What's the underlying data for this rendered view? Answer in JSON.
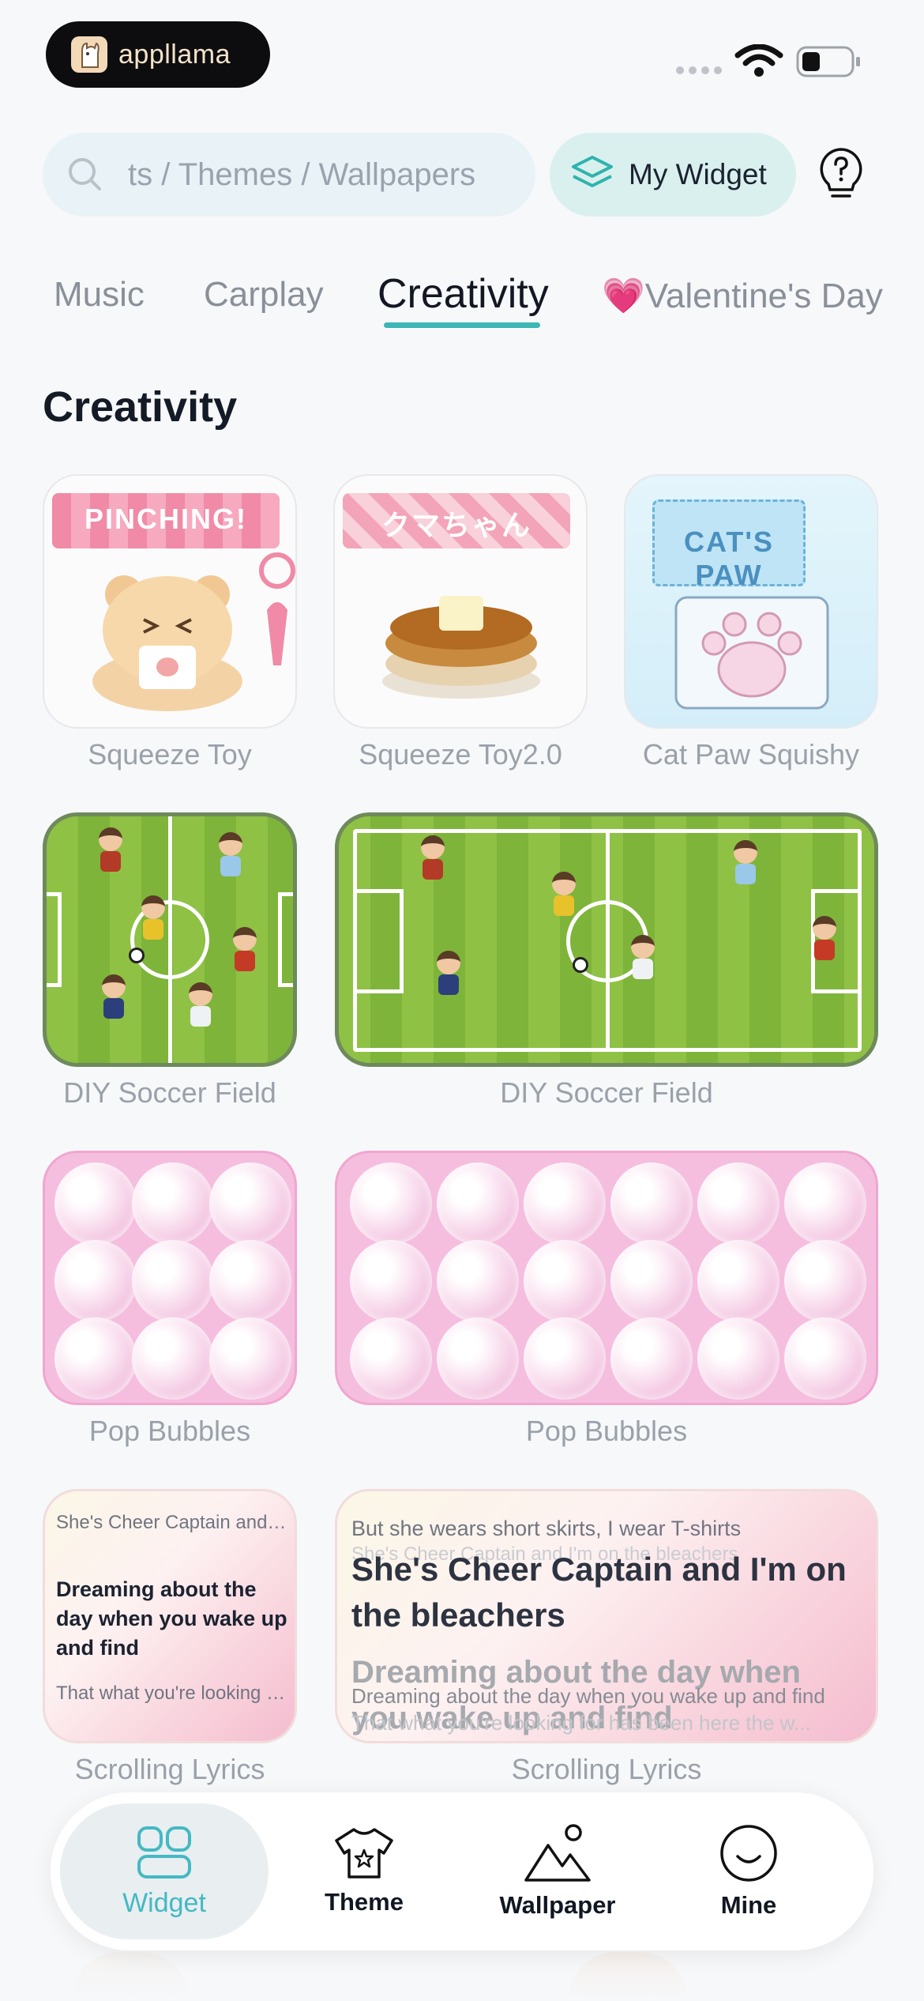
{
  "status_bar": {
    "app_name": "appllama"
  },
  "search": {
    "placeholder": "ts / Themes / Wallpapers"
  },
  "my_widget_label": "My Widget",
  "tabs": [
    {
      "label": "Music"
    },
    {
      "label": "Carplay"
    },
    {
      "label": "Creativity"
    },
    {
      "label": "Valentine's Day",
      "emoji": "💗"
    }
  ],
  "active_tab": "Creativity",
  "section_title": "Creativity",
  "widgets": [
    {
      "label": "Squeeze Toy",
      "tag_text": "PINCHING!"
    },
    {
      "label": "Squeeze Toy2.0",
      "tag_text": "クマちゃん"
    },
    {
      "label": "Cat Paw Squishy",
      "tag_text": "CAT'S PAW"
    },
    {
      "label": "DIY Soccer Field"
    },
    {
      "label": "DIY Soccer Field"
    },
    {
      "label": "Pop Bubbles"
    },
    {
      "label": "Pop Bubbles"
    },
    {
      "label": "Scrolling Lyrics"
    },
    {
      "label": "Scrolling Lyrics"
    }
  ],
  "lyrics_small": {
    "top": "She's Cheer Captain and I'...",
    "main": "Dreaming about the day when you wake up and find",
    "bottom": "That what you're looking fo..."
  },
  "lyrics_large": {
    "top": "But she wears short skirts, I wear T-shirts",
    "top_ghost": "She's Cheer Captain and I'm on the bleachers",
    "main": "She's Cheer Captain and I'm on the bleachers",
    "fade": "Dreaming about the day when you wake up and find",
    "fade_small": "Dreaming about the day when you wake up and find",
    "fade_ghost": "That what you're looking for has been here the w..."
  },
  "bottom_nav": [
    {
      "label": "Widget",
      "icon": "widget-grid-icon",
      "active": true
    },
    {
      "label": "Theme",
      "icon": "theme-shirt-icon"
    },
    {
      "label": "Wallpaper",
      "icon": "wallpaper-mountain-icon"
    },
    {
      "label": "Mine",
      "icon": "mine-smile-icon"
    }
  ],
  "colors": {
    "accent": "#3bb7b5",
    "nav_active": "#43b9c3"
  }
}
